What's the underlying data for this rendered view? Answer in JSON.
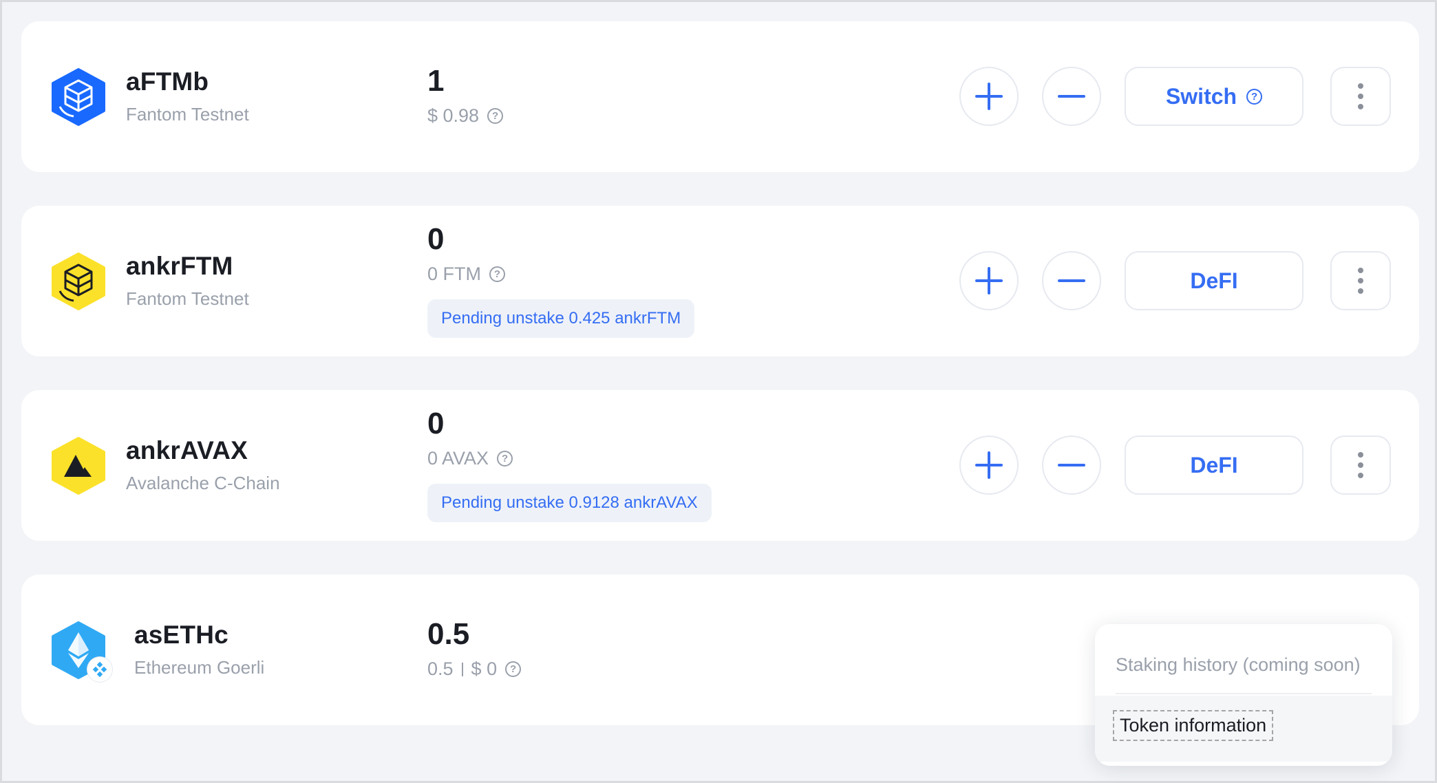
{
  "colors": {
    "accent": "#356df3",
    "muted_text": "#9aa0ab",
    "primary_text": "#1b1d24",
    "background": "#f2f4f7",
    "fantom_blue": "#1969ff",
    "ankr_yellow": "#fbe129",
    "eth_blue": "#30a9f4"
  },
  "tokens": [
    {
      "name": "aFTMb",
      "network": "Fantom Testnet",
      "icon": "fantom-cube-icon",
      "amount": "1",
      "sub_value": "$ 0.98",
      "action_label": "Switch",
      "action_has_help": true
    },
    {
      "name": "ankrFTM",
      "network": "Fantom Testnet",
      "icon": "ankr-fantom-cube-icon",
      "amount": "0",
      "sub_value": "0 FTM",
      "pending": "Pending unstake 0.425 ankrFTM",
      "action_label": "DeFI"
    },
    {
      "name": "ankrAVAX",
      "network": "Avalanche C-Chain",
      "icon": "ankr-avalanche-icon",
      "amount": "0",
      "sub_value": "0 AVAX",
      "pending": "Pending unstake 0.9128 ankrAVAX",
      "action_label": "DeFI"
    },
    {
      "name": "asETHc",
      "network": "Ethereum Goerli",
      "icon": "ethereum-icon",
      "amount": "0.5",
      "sub_value_amount": "0.5",
      "sub_value_usd": "$ 0"
    }
  ],
  "help_glyph": "?",
  "menu": {
    "items": [
      {
        "label": "Staking history (coming soon)",
        "disabled": true
      },
      {
        "label": "Token information",
        "focused": true
      }
    ]
  }
}
